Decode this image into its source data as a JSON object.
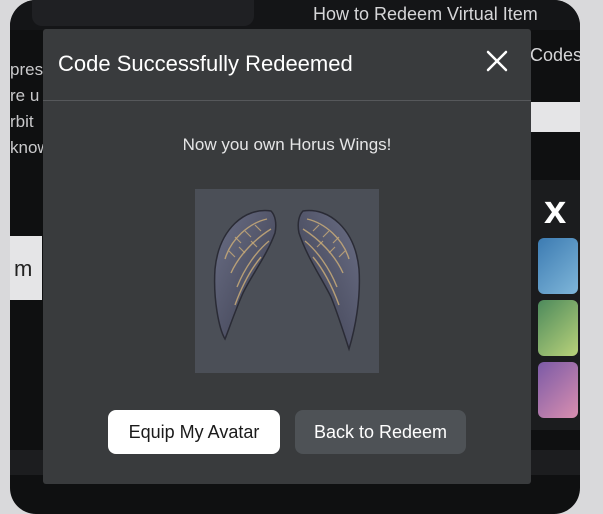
{
  "background": {
    "top_link": "How to Redeem Virtual Item",
    "right_link": "Codes",
    "left_lines": [
      "pres",
      "re u",
      "rbit",
      "know"
    ],
    "left_input_text": "m",
    "promo_letter": "x"
  },
  "dialog": {
    "title": "Code Successfully Redeemed",
    "close_icon": "close-icon",
    "message": "Now you own Horus Wings!",
    "item_image": "horus-wings-image",
    "buttons": {
      "equip": "Equip My Avatar",
      "back": "Back to Redeem"
    }
  },
  "colors": {
    "dialog_bg": "#393b3d",
    "primary_button": "#ffffff",
    "secondary_button": "#4e5256",
    "item_bg": "#4b4f57"
  }
}
